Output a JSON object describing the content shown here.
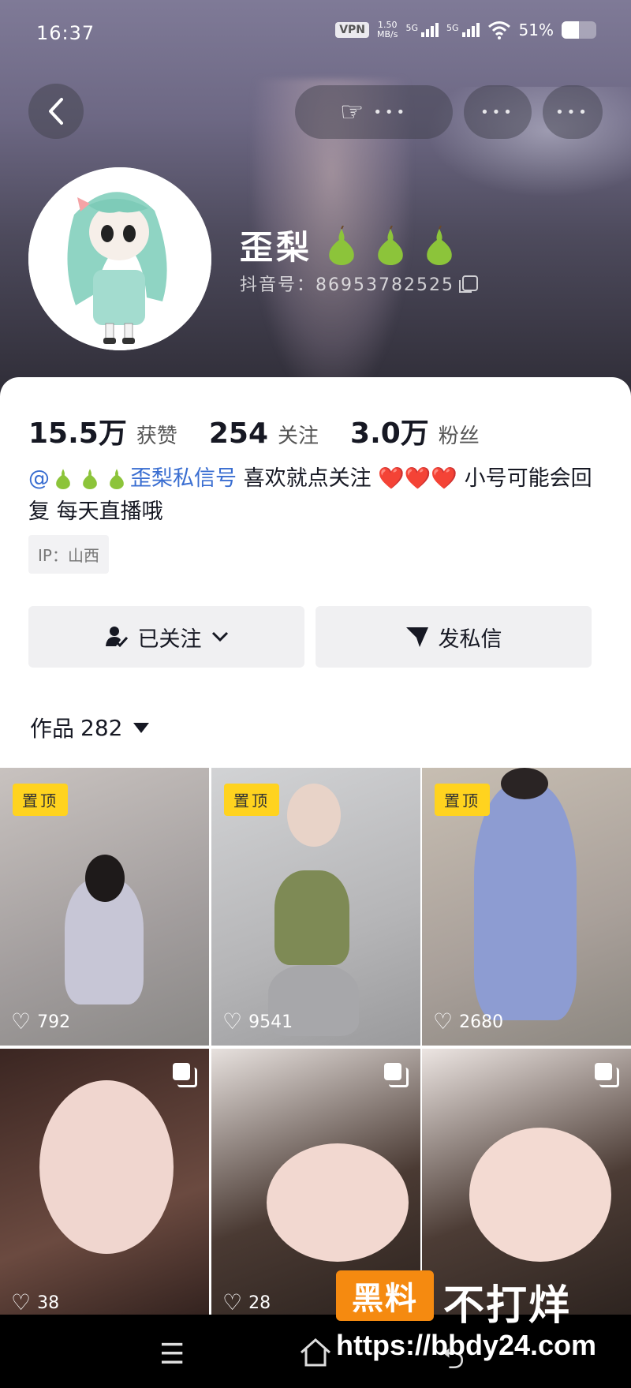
{
  "status_bar": {
    "time": "16:37",
    "vpn": "VPN",
    "speed_value": "1.50",
    "speed_unit": "MB/s",
    "signal1": "5G",
    "signal2": "5G",
    "battery_percent": "51%",
    "battery_level": 0.51
  },
  "header": {
    "nickname": "歪梨",
    "nickname_emoji": [
      "pear",
      "pear",
      "pear"
    ],
    "douyin_id": "抖音号：86953782525"
  },
  "stats": [
    {
      "value": "15.5万",
      "label": "获赞"
    },
    {
      "value": "254",
      "label": "关注"
    },
    {
      "value": "3.0万",
      "label": "粉丝"
    }
  ],
  "bio": {
    "at": "@",
    "mention": "歪梨私信号",
    "text1": " 喜欢就点关注 ",
    "hearts": "❤️❤️❤️",
    "text2": " 小号可能会回复  每天直播哦"
  },
  "ip_tag": "IP：山西",
  "actions": {
    "follow_label": "已关注",
    "dm_label": "发私信"
  },
  "works_tab": {
    "label": "作品",
    "count": "282"
  },
  "grid": [
    {
      "pinned": true,
      "pin_label": "置顶",
      "likes": "792",
      "multi": false
    },
    {
      "pinned": true,
      "pin_label": "置顶",
      "likes": "9541",
      "multi": false
    },
    {
      "pinned": true,
      "pin_label": "置顶",
      "likes": "2680",
      "multi": false
    },
    {
      "pinned": false,
      "pin_label": "",
      "likes": "38",
      "multi": true
    },
    {
      "pinned": false,
      "pin_label": "",
      "likes": "28",
      "multi": true
    },
    {
      "pinned": false,
      "pin_label": "",
      "likes": "",
      "multi": true
    }
  ],
  "watermark": {
    "box_text": "黑料",
    "main_text": "不打烊",
    "url": "https://bbdy24.com"
  },
  "colors": {
    "accent_link": "#3a6ed1",
    "pin_yellow": "#ffd31f",
    "heart_red": "#e3232b",
    "watermark_orange": "#f58a10"
  },
  "icons": [
    "back-arrow-icon",
    "share-hand-icon",
    "search-icon",
    "more-icon",
    "copy-icon",
    "follow-user-icon",
    "chevron-down-icon",
    "send-icon",
    "caret-down-icon",
    "heart-icon",
    "multi-image-icon",
    "menu-icon",
    "home-icon",
    "back-nav-icon"
  ]
}
